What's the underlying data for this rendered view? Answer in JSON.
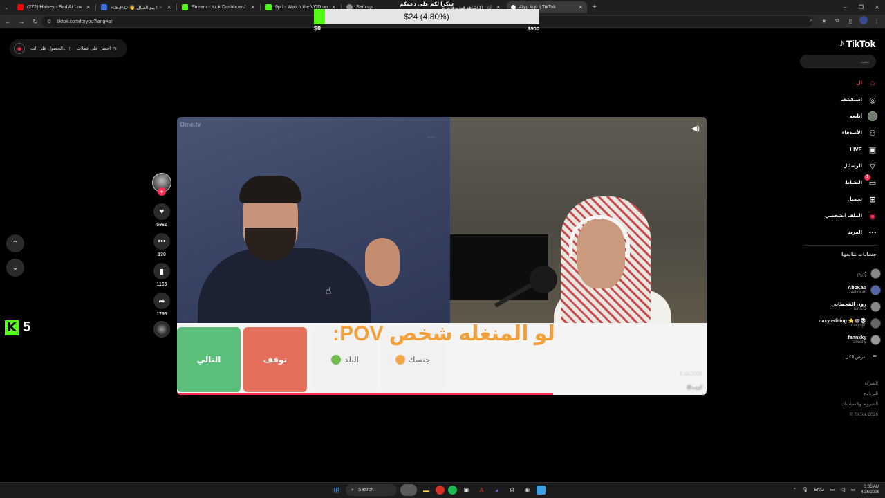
{
  "browser": {
    "tabs": [
      {
        "title": "(272) Halsey - Bad At Love",
        "favicon_color": "#ff0000",
        "active": false
      },
      {
        "title": "R.E.P.O 👋 بيع العيال !! - Reti",
        "favicon_color": "#3e6ed6",
        "active": false
      },
      {
        "title": "Stream - Kick Dashboard",
        "favicon_color": "#53fc18",
        "active": false
      },
      {
        "title": "9prl - Watch the VOD on Kick",
        "favicon_color": "#53fc18",
        "active": false
      },
      {
        "title": "Settings",
        "favicon_color": "#8a8a8a",
        "active": false
      },
      {
        "title": "(1)شاهد فيديوهات مقتصرة",
        "favicon_color": "#ffffff",
        "active": false
      },
      {
        "title": "#fyp #qtr | TikTok",
        "favicon_color": "#ffffff",
        "active": true
      }
    ],
    "new_tab": "+",
    "url": "tiktok.com/foryou?lang=ar",
    "window_controls": [
      "–",
      "❐",
      "✕"
    ]
  },
  "donation": {
    "message": "شكرا لكم على دعمكم",
    "amount_text": "$24 (4.80%)",
    "progress_fraction": 0.048,
    "min_label": "$0",
    "max_label": "$500",
    "fill_color": "#53fc18"
  },
  "tiktok": {
    "get_app": {
      "coins_label": "احصل على عملات",
      "app_label": "الحصول على الت..."
    },
    "logo_text": "TikTok",
    "search_placeholder": "بحث",
    "nav": [
      {
        "label": "ال",
        "icon": "home-icon",
        "glyph": "⌂",
        "active": true
      },
      {
        "label": "استكشف",
        "icon": "compass-icon",
        "glyph": "◎"
      },
      {
        "label": "أتابعه",
        "icon": "following-avatar-icon",
        "glyph": ""
      },
      {
        "label": "الأصدقاء",
        "icon": "friends-icon",
        "glyph": "👥"
      },
      {
        "label": "LIVE",
        "icon": "live-icon",
        "glyph": "▣"
      },
      {
        "label": "الرسائل",
        "icon": "send-icon",
        "glyph": "▽"
      },
      {
        "label": "النشاط",
        "icon": "inbox-icon",
        "glyph": "▭",
        "badge": "1"
      },
      {
        "label": "تحميل",
        "icon": "upload-icon",
        "glyph": "⊞"
      },
      {
        "label": "الملف الشخصي",
        "icon": "profile-icon",
        "glyph": "◉"
      },
      {
        "label": "المزيد",
        "icon": "more-icon",
        "glyph": "⋯"
      }
    ],
    "following_title": "حسابات تتابعها",
    "following": [
      {
        "name": ".",
        "handle": "l7b7r",
        "avatar_color": "#8b8b8b"
      },
      {
        "name": "AboKab",
        "handle": "vabokab",
        "avatar_color": "#5566aa"
      },
      {
        "name": "رون القحطاني",
        "handle": "ronn.l1",
        "avatar_color": "#888888"
      },
      {
        "name": "naxy editing ⭐🐨💀",
        "handle": "naxysy0",
        "avatar_color": "#666666"
      },
      {
        "name": "fannxky",
        "handle": "fannxky",
        "avatar_color": "#999999"
      }
    ],
    "see_all": "عرض الكل",
    "footer": [
      "الشركة",
      "البرنامج",
      "الشروط والسياسات",
      "© TikTok 2026"
    ],
    "video": {
      "overlay_text": "لو المنغله شخص POV:",
      "site_watermark": "Ome.tv",
      "buttons": {
        "next": "التالي",
        "stop": "توقف",
        "country": "البلد",
        "gender": "جنسك"
      },
      "author_watermark": "fr.ak2006",
      "caption_user": "@كيوب",
      "progress_fraction": 0.71
    },
    "actions": {
      "likes": "5961",
      "comments": "130",
      "saves": "1155",
      "shares": "1795"
    }
  },
  "kick_widget": {
    "logo": "K",
    "count": "5"
  },
  "taskbar": {
    "search_label": "Search",
    "lang": "ENG",
    "time": "3:05 AM",
    "date": "4/26/2026"
  }
}
